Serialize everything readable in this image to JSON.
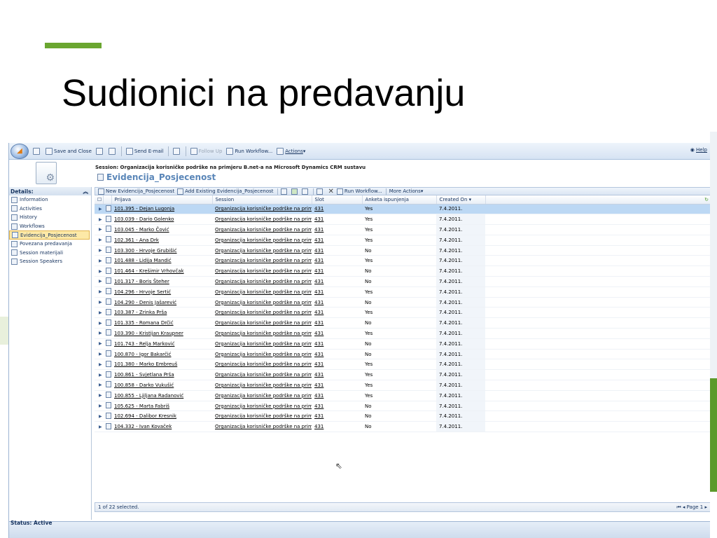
{
  "slide": {
    "title": "Sudionici na predavanju",
    "accent_color": "#6aa630"
  },
  "toolbar": {
    "save_close": "Save and Close",
    "send_email": "Send E-mail",
    "follow_up": "Follow Up",
    "run_workflow": "Run Workflow...",
    "actions": "Actions",
    "help": "Help"
  },
  "header": {
    "session": "Session: Organizacija korisničke podrške na primjeru B.net-a na Microsoft Dynamics CRM sustavu",
    "entity": "Evidencija_Posjecenost"
  },
  "sidebar": {
    "details_label": "Details:",
    "items": [
      {
        "label": "Information",
        "icon": "document-icon"
      },
      {
        "label": "Activities",
        "icon": "activities-icon"
      },
      {
        "label": "History",
        "icon": "history-icon"
      },
      {
        "label": "Workflows",
        "icon": "workflow-icon"
      },
      {
        "label": "Evidencija_Posjecenost",
        "icon": "document-icon",
        "active": true
      },
      {
        "label": "Povezana predavanja",
        "icon": "document-icon"
      },
      {
        "label": "Session materijali",
        "icon": "document-icon"
      },
      {
        "label": "Session Speakers",
        "icon": "document-icon"
      }
    ]
  },
  "grid_toolbar": {
    "new": "New Evidencija_Posjecenost",
    "add_existing": "Add Existing Evidencija_Posjecenost",
    "run_workflow": "Run Workflow...",
    "more_actions": "More Actions"
  },
  "grid": {
    "columns": [
      "Prijava",
      "Session",
      "Slot",
      "Anketa ispunjenja",
      "Created On"
    ],
    "rows": [
      {
        "prijava": "101.395 - Dejan Lugonja",
        "session": "Organizacija korisničke podrške na primj",
        "slot": "431",
        "anketa": "Yes",
        "created": "7.4.2011."
      },
      {
        "prijava": "103.039 - Dario Golenko",
        "session": "Organizacija korisničke podrške na primj",
        "slot": "431",
        "anketa": "Yes",
        "created": "7.4.2011."
      },
      {
        "prijava": "103.045 - Marko Čović",
        "session": "Organizacija korisničke podrške na primj",
        "slot": "431",
        "anketa": "Yes",
        "created": "7.4.2011."
      },
      {
        "prijava": "102.361 - Ana Drk",
        "session": "Organizacija korisničke podrške na primj",
        "slot": "431",
        "anketa": "Yes",
        "created": "7.4.2011."
      },
      {
        "prijava": "103.300 - Hrvoje Grubišić",
        "session": "Organizacija korisničke podrške na primj",
        "slot": "431",
        "anketa": "No",
        "created": "7.4.2011."
      },
      {
        "prijava": "101.488 - Lidija Mandić",
        "session": "Organizacija korisničke podrške na primj",
        "slot": "431",
        "anketa": "Yes",
        "created": "7.4.2011."
      },
      {
        "prijava": "101.464 - Krešimir Vrhovčak",
        "session": "Organizacija korisničke podrške na primj",
        "slot": "431",
        "anketa": "No",
        "created": "7.4.2011."
      },
      {
        "prijava": "101.317 - Boris Šteher",
        "session": "Organizacija korisničke podrške na primj",
        "slot": "431",
        "anketa": "No",
        "created": "7.4.2011."
      },
      {
        "prijava": "104.296 - Hrvoje Sertić",
        "session": "Organizacija korisničke podrške na primj",
        "slot": "431",
        "anketa": "Yes",
        "created": "7.4.2011."
      },
      {
        "prijava": "104.290 - Denis Jašarević",
        "session": "Organizacija korisničke podrške na primj",
        "slot": "431",
        "anketa": "No",
        "created": "7.4.2011."
      },
      {
        "prijava": "103.387 - Zrinka Prša",
        "session": "Organizacija korisničke podrške na primj",
        "slot": "431",
        "anketa": "Yes",
        "created": "7.4.2011."
      },
      {
        "prijava": "101.335 - Romana Drčić",
        "session": "Organizacija korisničke podrške na primj",
        "slot": "431",
        "anketa": "No",
        "created": "7.4.2011."
      },
      {
        "prijava": "103.390 - Kristijan Kraupner",
        "session": "Organizacija korisničke podrške na primj",
        "slot": "431",
        "anketa": "Yes",
        "created": "7.4.2011."
      },
      {
        "prijava": "101.743 - Relja Marković",
        "session": "Organizacija korisničke podrške na primj",
        "slot": "431",
        "anketa": "No",
        "created": "7.4.2011."
      },
      {
        "prijava": "100.870 - Igor Bakarčić",
        "session": "Organizacija korisničke podrške na primj",
        "slot": "431",
        "anketa": "No",
        "created": "7.4.2011."
      },
      {
        "prijava": "101.380 - Marko Embreuš",
        "session": "Organizacija korisničke podrške na primj",
        "slot": "431",
        "anketa": "Yes",
        "created": "7.4.2011."
      },
      {
        "prijava": "100.861 - Svjetlana Prša",
        "session": "Organizacija korisničke podrške na primj",
        "slot": "431",
        "anketa": "Yes",
        "created": "7.4.2011."
      },
      {
        "prijava": "100.858 - Darko Vukušić",
        "session": "Organizacija korisničke podrške na primj",
        "slot": "431",
        "anketa": "Yes",
        "created": "7.4.2011."
      },
      {
        "prijava": "100.855 - Ljiljana Radanović",
        "session": "Organizacija korisničke podrške na primj",
        "slot": "431",
        "anketa": "Yes",
        "created": "7.4.2011."
      },
      {
        "prijava": "105.625 - Marta Fabriš",
        "session": "Organizacija korisničke podrške na primj",
        "slot": "431",
        "anketa": "No",
        "created": "7.4.2011."
      },
      {
        "prijava": "102.694 - Dalibor Kresnik",
        "session": "Organizacija korisničke podrške na primj",
        "slot": "431",
        "anketa": "No",
        "created": "7.4.2011."
      },
      {
        "prijava": "104.332 - Ivan Kovaček",
        "session": "Organizacija korisničke podrške na primj",
        "slot": "431",
        "anketa": "No",
        "created": "7.4.2011."
      }
    ],
    "selected_index": 0,
    "footer_selected": "1 of 22 selected.",
    "footer_page": "Page 1"
  },
  "status": "Status: Active"
}
